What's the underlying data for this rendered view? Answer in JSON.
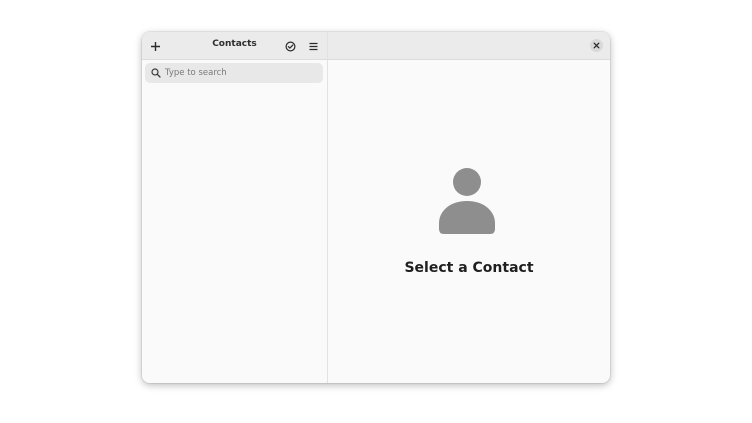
{
  "window": {
    "title": "Contacts"
  },
  "sidebar": {
    "add_button_icon": "plus-icon",
    "select_button_icon": "check-circle-icon",
    "menu_button_icon": "hamburger-menu-icon",
    "search": {
      "placeholder": "Type to search",
      "value": "",
      "icon": "search-icon"
    }
  },
  "main": {
    "close_button_icon": "close-icon",
    "empty_state": {
      "icon": "avatar-icon",
      "title": "Select a Contact"
    }
  },
  "colors": {
    "header_bg": "#ebebeb",
    "window_bg": "#fafafa",
    "search_bg": "#e8e8e8",
    "avatar_gray": "#8e8e8e",
    "text_dark": "#1f1f1f"
  }
}
